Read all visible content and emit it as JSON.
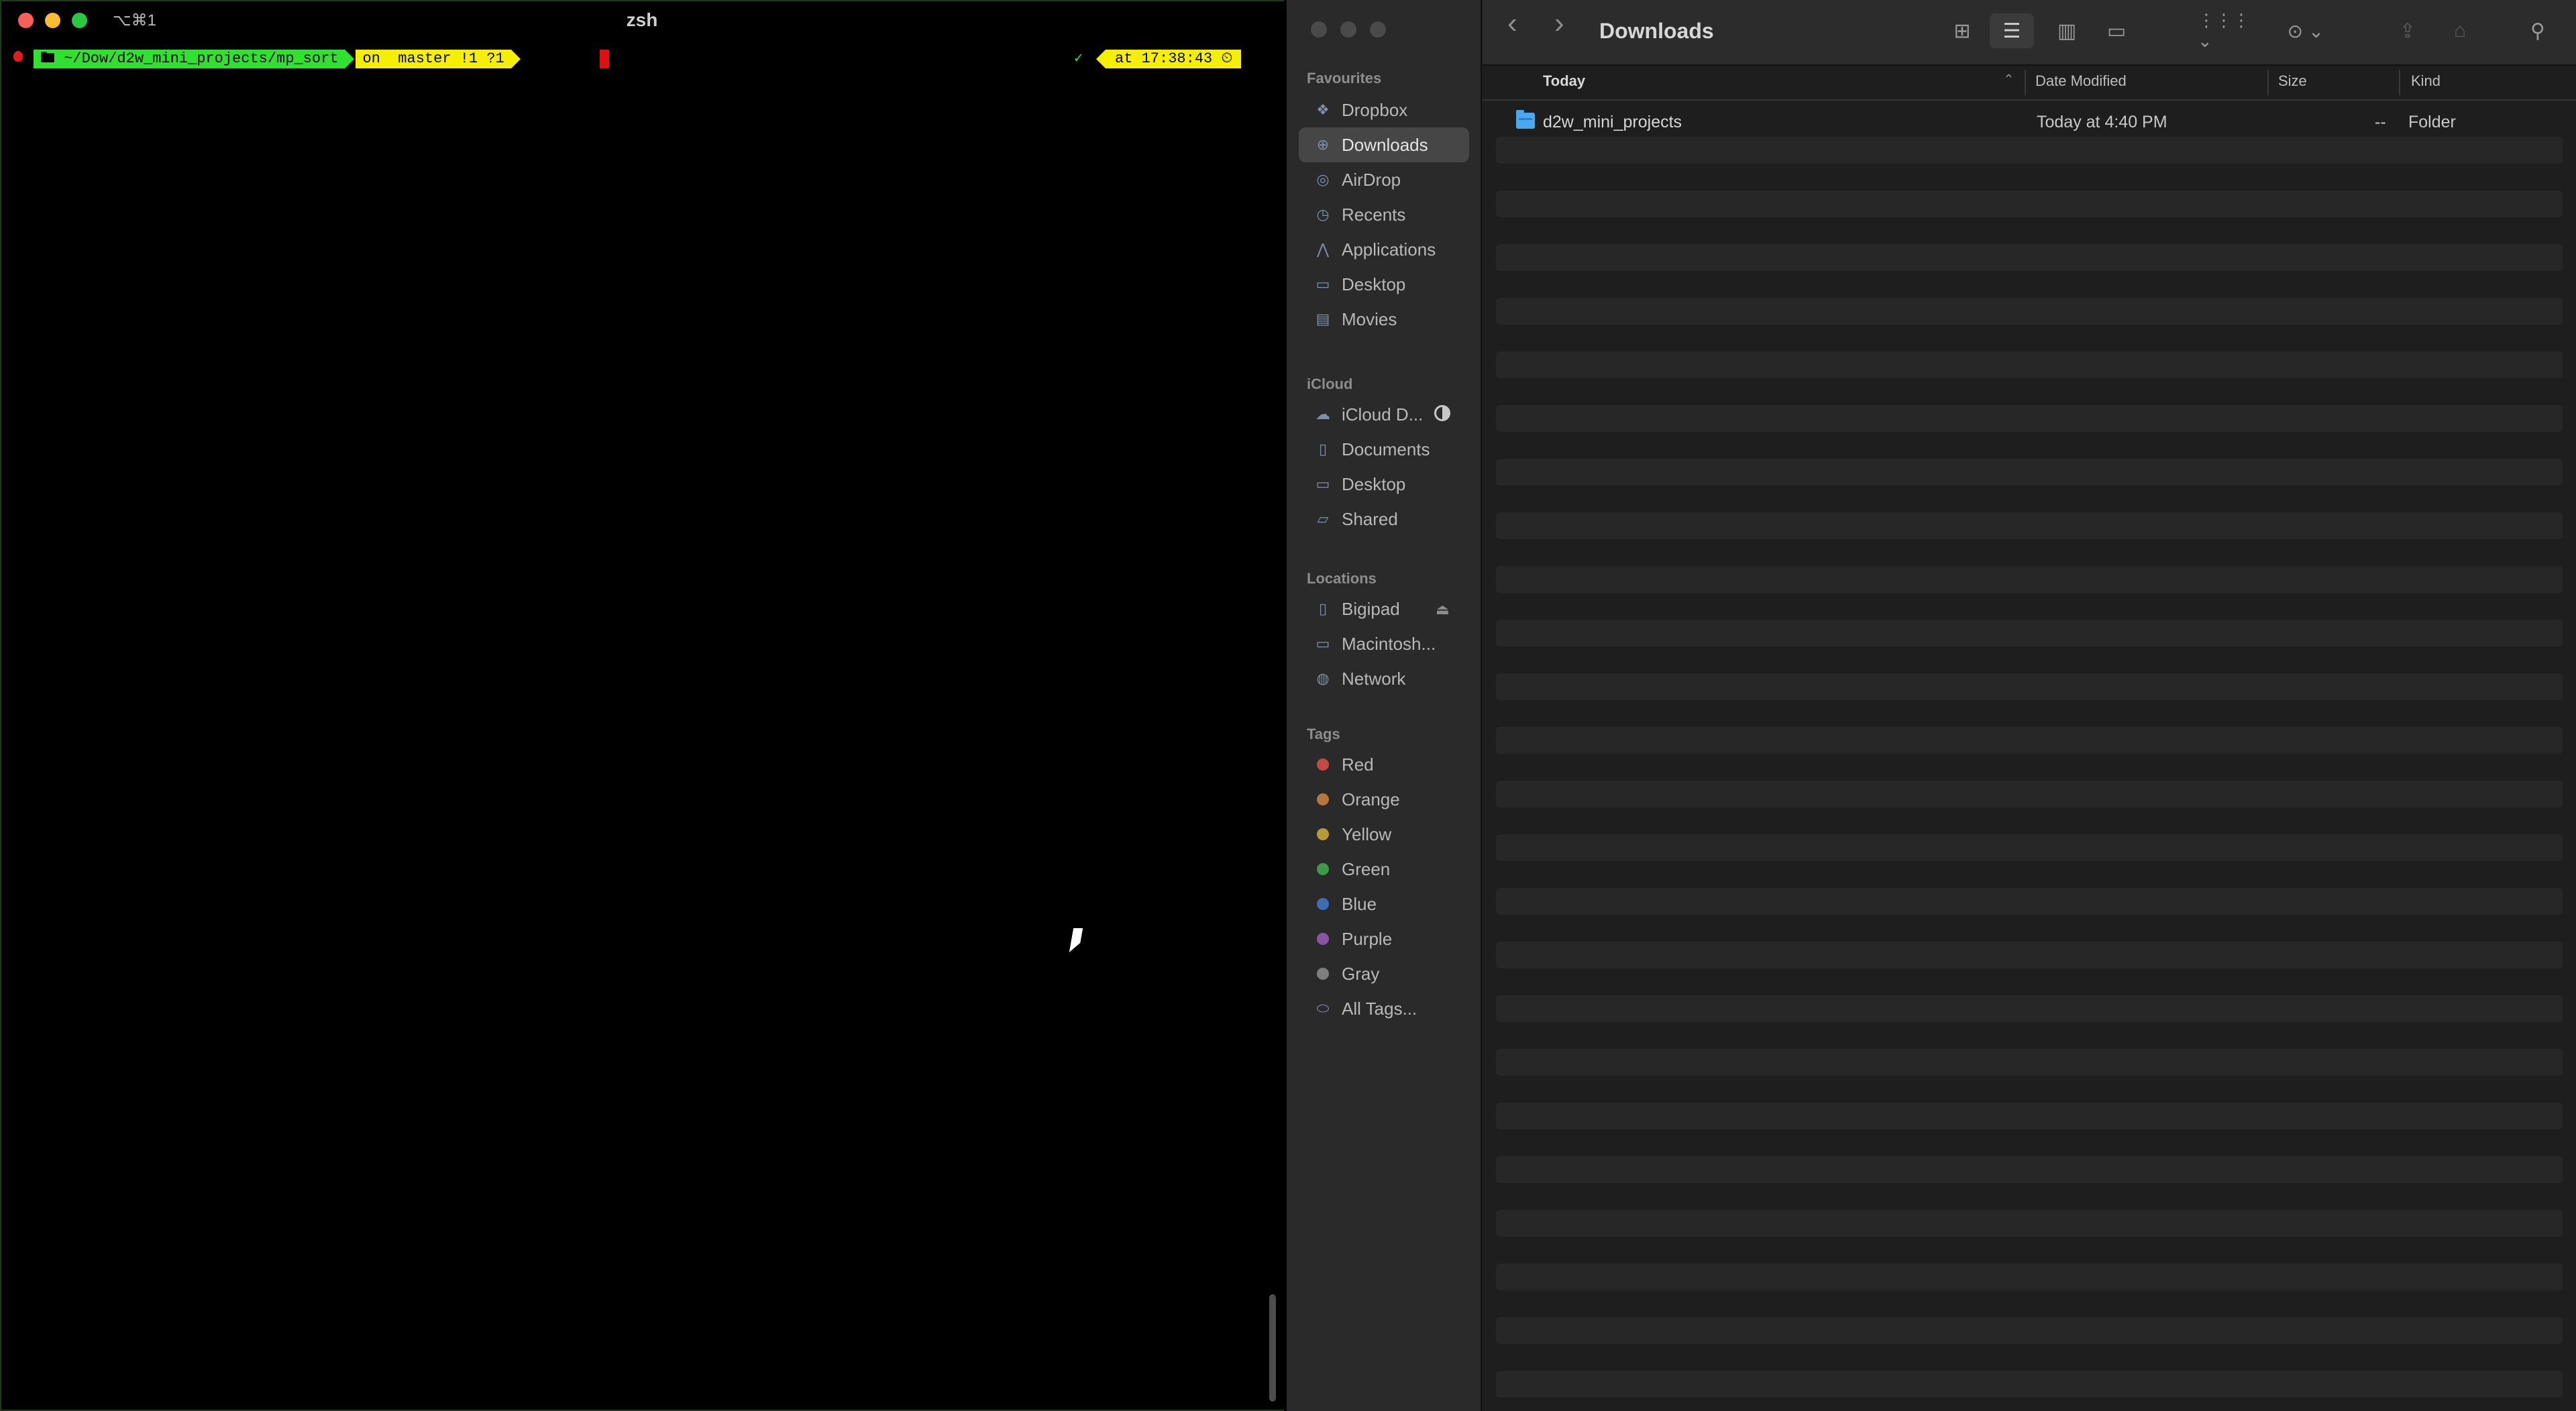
{
  "terminal": {
    "shortcut": "⌥⌘1",
    "title": "zsh",
    "prompt": {
      "path": "🖿 ~/Dow/d2w_mini_projects/mp_sort",
      "git": "on  master !1 ?1",
      "status_check": "✓",
      "time": "at 17:38:43 ⏲"
    }
  },
  "finder": {
    "title": "Downloads",
    "toolbar": {
      "back_icon": "‹",
      "forward_icon": "›",
      "icon_view": "⊞",
      "list_view": "☰",
      "column_view": "▥",
      "gallery_view": "▭",
      "group_icon": "⋮⋮⋮ ⌄",
      "action_icon": "⊙ ⌄",
      "share_icon": "⇪",
      "tag_icon": "⌂",
      "search_icon": "⚲"
    },
    "sidebar": {
      "favourites_header": "Favourites",
      "favourites": [
        {
          "label": "Dropbox",
          "icon": "dropbox-icon",
          "glyph": "❖"
        },
        {
          "label": "Downloads",
          "icon": "downloads-icon",
          "glyph": "⊕",
          "selected": true
        },
        {
          "label": "AirDrop",
          "icon": "airdrop-icon",
          "glyph": "◎"
        },
        {
          "label": "Recents",
          "icon": "clock-icon",
          "glyph": "◷"
        },
        {
          "label": "Applications",
          "icon": "applications-icon",
          "glyph": "⋀"
        },
        {
          "label": "Desktop",
          "icon": "desktop-icon",
          "glyph": "▭"
        },
        {
          "label": "Movies",
          "icon": "movies-icon",
          "glyph": "▤"
        }
      ],
      "icloud_header": "iCloud",
      "icloud": [
        {
          "label": "iCloud D...",
          "icon": "cloud-icon",
          "glyph": "☁"
        },
        {
          "label": "Documents",
          "icon": "document-icon",
          "glyph": "▯"
        },
        {
          "label": "Desktop",
          "icon": "desktop-icon",
          "glyph": "▭"
        },
        {
          "label": "Shared",
          "icon": "shared-folder-icon",
          "glyph": "▱"
        }
      ],
      "locations_header": "Locations",
      "locations": [
        {
          "label": "Bigipad",
          "icon": "ipad-icon",
          "glyph": "▯"
        },
        {
          "label": "Macintosh...",
          "icon": "disk-icon",
          "glyph": "▭"
        },
        {
          "label": "Network",
          "icon": "globe-icon",
          "glyph": "◍"
        }
      ],
      "tags_header": "Tags",
      "tags": [
        {
          "label": "Red",
          "color": "#c44b45"
        },
        {
          "label": "Orange",
          "color": "#b8763c"
        },
        {
          "label": "Yellow",
          "color": "#b59a36"
        },
        {
          "label": "Green",
          "color": "#3c9a48"
        },
        {
          "label": "Blue",
          "color": "#3a6fb4"
        },
        {
          "label": "Purple",
          "color": "#8a54a4"
        },
        {
          "label": "Gray",
          "color": "#7e7e7e"
        },
        {
          "label": "All Tags...",
          "color": ""
        }
      ]
    },
    "columns": {
      "name": "Today",
      "date": "Date Modified",
      "size": "Size",
      "kind": "Kind"
    },
    "files": [
      {
        "name": "d2w_mini_projects",
        "date": "Today at 4:40 PM",
        "size": "--",
        "kind": "Folder"
      }
    ]
  }
}
